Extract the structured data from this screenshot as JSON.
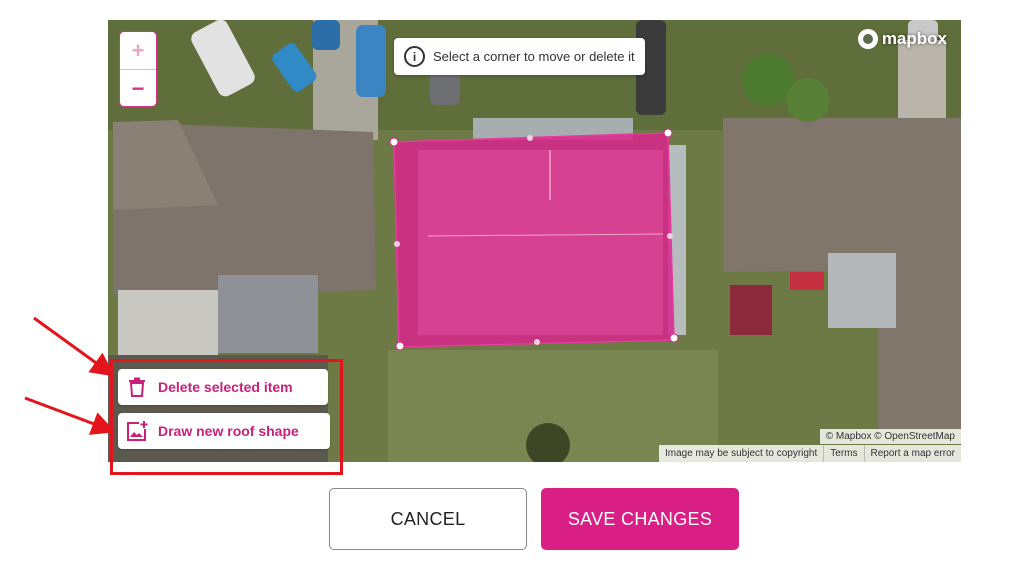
{
  "map": {
    "zoom_in_label": "+",
    "zoom_out_label": "−",
    "tooltip_icon_glyph": "i",
    "tooltip_text": "Select a corner to move or delete it",
    "logo_text": "mapbox",
    "roof_color": "#d9248c",
    "attribution": "© Mapbox © OpenStreetMap",
    "footer_links": [
      "Image may be subject to copyright",
      "Terms",
      "Report a map error"
    ]
  },
  "tools": {
    "delete_label": "Delete selected item",
    "delete_icon": "trash-icon",
    "draw_label": "Draw new roof shape",
    "draw_icon": "add-image-icon"
  },
  "actions": {
    "cancel_label": "CANCEL",
    "save_label": "SAVE CHANGES"
  },
  "colors": {
    "accent": "#d91e86",
    "annotation_red": "#e3141b"
  }
}
